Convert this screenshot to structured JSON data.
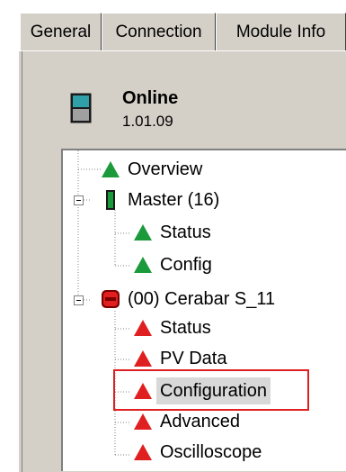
{
  "tabs": [
    {
      "label": "General"
    },
    {
      "label": "Connection"
    },
    {
      "label": "Module Info"
    }
  ],
  "status": {
    "title": "Online",
    "version": "1.01.09"
  },
  "tree": {
    "items": [
      {
        "label": "Overview"
      },
      {
        "label": "Master (16)"
      },
      {
        "label": "Status"
      },
      {
        "label": "Config"
      },
      {
        "label": "(00) Cerabar S_11"
      },
      {
        "label": "Status"
      },
      {
        "label": "PV Data"
      },
      {
        "label": "Configuration"
      },
      {
        "label": "Advanced"
      },
      {
        "label": "Oscilloscope"
      }
    ]
  },
  "colors": {
    "ok_green": "#1a9a3a",
    "error_red": "#e02020",
    "highlight_box": "#e02020"
  }
}
